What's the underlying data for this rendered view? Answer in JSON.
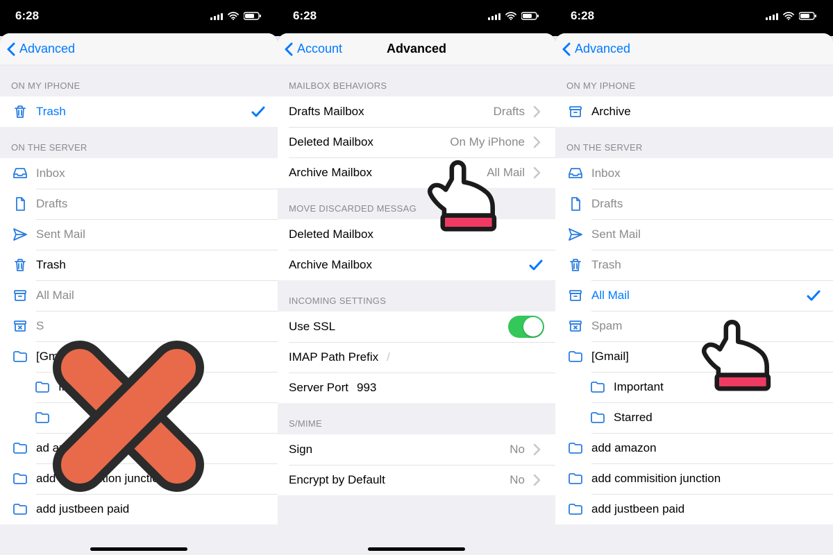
{
  "status": {
    "time": "6:28"
  },
  "screen1": {
    "back": "Advanced",
    "sec_on_phone": "ON MY IPHONE",
    "sec_on_server": "ON THE SERVER",
    "rows": {
      "trash": "Trash",
      "inbox": "Inbox",
      "drafts": "Drafts",
      "sent": "Sent Mail",
      "trash2": "Trash",
      "allmail": "All Mail",
      "spam": "S",
      "gmail": "[Gma",
      "important": "Impor",
      "starred": "",
      "add_amazon": "ad        azon",
      "add_cj": "add commisition junction",
      "add_jbp": "add justbeen paid"
    }
  },
  "screen2": {
    "back": "Account",
    "title": "Advanced",
    "sec_behaviors": "MAILBOX BEHAVIORS",
    "sec_discarded": "MOVE DISCARDED MESSAG",
    "sec_incoming": "INCOMING SETTINGS",
    "sec_smime": "S/MIME",
    "rows": {
      "drafts_mb": {
        "label": "Drafts Mailbox",
        "value": "Drafts"
      },
      "deleted_mb": {
        "label": "Deleted Mailbox",
        "value": "On My iPhone"
      },
      "archive_mb": {
        "label": "Archive Mailbox",
        "value": "All Mail"
      },
      "deleted2": "Deleted Mailbox",
      "archive2": "Archive Mailbox",
      "use_ssl": "Use SSL",
      "imap_prefix": {
        "label": "IMAP Path Prefix",
        "value": "/"
      },
      "server_port": {
        "label": "Server Port",
        "value": "993"
      },
      "sign": {
        "label": "Sign",
        "value": "No"
      },
      "encrypt": {
        "label": "Encrypt by Default",
        "value": "No"
      }
    }
  },
  "screen3": {
    "back": "Advanced",
    "sec_on_phone": "ON MY IPHONE",
    "sec_on_server": "ON THE SERVER",
    "rows": {
      "archive": "Archive",
      "inbox": "Inbox",
      "drafts": "Drafts",
      "sent": "Sent Mail",
      "trash": "Trash",
      "allmail": "All Mail",
      "spam": "Spam",
      "gmail": "[Gmail]",
      "important": "Important",
      "starred": "Starred",
      "add_amazon": "add amazon",
      "add_cj": "add commisition junction",
      "add_jbp": "add justbeen paid"
    }
  }
}
